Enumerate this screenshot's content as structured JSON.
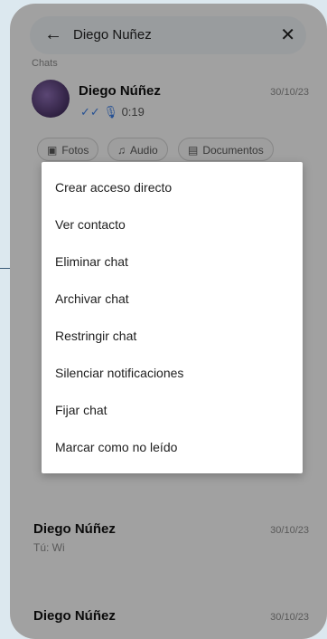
{
  "search": {
    "back_icon": "←",
    "query": "Diego Nuñez",
    "close_icon": "✕"
  },
  "section_label": "Chats",
  "chats": [
    {
      "name": "Diego Núñez",
      "date": "30/10/23",
      "voice_duration": "0:19"
    },
    {
      "name": "Diego Núñez",
      "date": "30/10/23",
      "subtitle": "Tú: Wi"
    },
    {
      "name": "Diego Núñez",
      "date": "30/10/23"
    }
  ],
  "filters": [
    {
      "icon": "image-icon",
      "glyph": "▣",
      "label": "Fotos"
    },
    {
      "icon": "headphones-icon",
      "glyph": "♫",
      "label": "Audio"
    },
    {
      "icon": "document-icon",
      "glyph": "▤",
      "label": "Documentos"
    }
  ],
  "context_menu": {
    "items": [
      "Crear acceso directo",
      "Ver contacto",
      "Eliminar chat",
      "Archivar chat",
      "Restringir chat",
      "Silenciar notificaciones",
      "Fijar chat",
      "Marcar como no leído"
    ]
  },
  "colors": {
    "background": "#dce8ef",
    "accent_blue": "#3b7be0",
    "overlay": "rgba(0,0,0,0.34)",
    "callout_line": "#3a5a78"
  }
}
